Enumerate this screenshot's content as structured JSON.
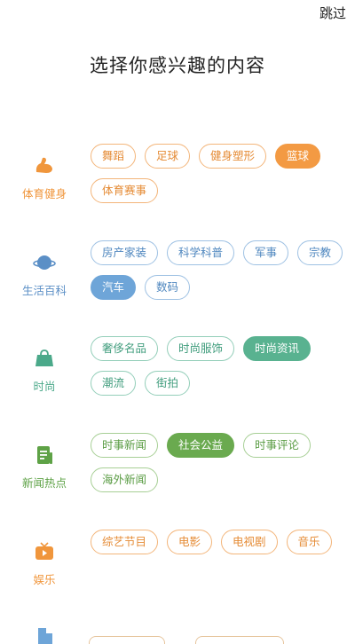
{
  "header": {
    "skip_label": "跳过",
    "title": "选择你感兴趣的内容"
  },
  "sections": [
    {
      "name": "体育健身",
      "color": "#f0963c",
      "icon": "muscle-arm-icon",
      "tags": [
        "舞蹈",
        "足球",
        "健身塑形",
        "篮球",
        "体育赛事"
      ],
      "selected": "篮球"
    },
    {
      "name": "生活百科",
      "color": "#5b8fc6",
      "icon": "planet-icon",
      "tags": [
        "房产家装",
        "科学科普",
        "军事",
        "宗教",
        "汽车",
        "数码"
      ],
      "selected": "汽车"
    },
    {
      "name": "时尚",
      "color": "#4ba98a",
      "icon": "handbag-icon",
      "tags": [
        "奢侈名品",
        "时尚服饰",
        "时尚资讯",
        "潮流",
        "街拍"
      ],
      "selected": "时尚资讯"
    },
    {
      "name": "新闻热点",
      "color": "#5ea246",
      "icon": "newspaper-icon",
      "tags": [
        "时事新闻",
        "社会公益",
        "时事评论",
        "海外新闻"
      ],
      "selected": "社会公益"
    },
    {
      "name": "娱乐",
      "color": "#f0963c",
      "icon": "tv-icon",
      "tags": [
        "综艺节目",
        "电影",
        "电视剧",
        "音乐"
      ],
      "selected": ""
    }
  ]
}
